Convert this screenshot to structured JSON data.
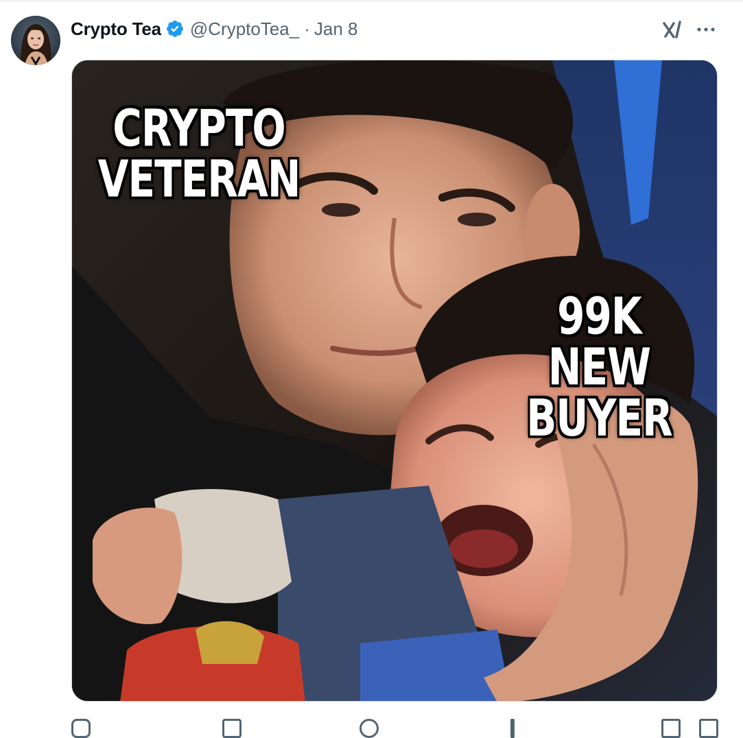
{
  "post": {
    "author": {
      "display_name": "Crypto Tea",
      "handle": "@CryptoTea_",
      "verified": true,
      "avatar_icon": "profile-photo"
    },
    "separator": "·",
    "date": "Jan 8",
    "icons": {
      "grok": "grok-icon",
      "more": "more-options-icon"
    },
    "media": {
      "captions": {
        "top_left": [
          "CRYPTO",
          "VETERAN"
        ],
        "bottom_right": [
          "99K",
          "NEW BUYER"
        ]
      }
    }
  },
  "colors": {
    "verified_badge": "#1d9bf0",
    "secondary_text": "#536471",
    "primary_text": "#0f1419",
    "border": "#cfd9de"
  }
}
